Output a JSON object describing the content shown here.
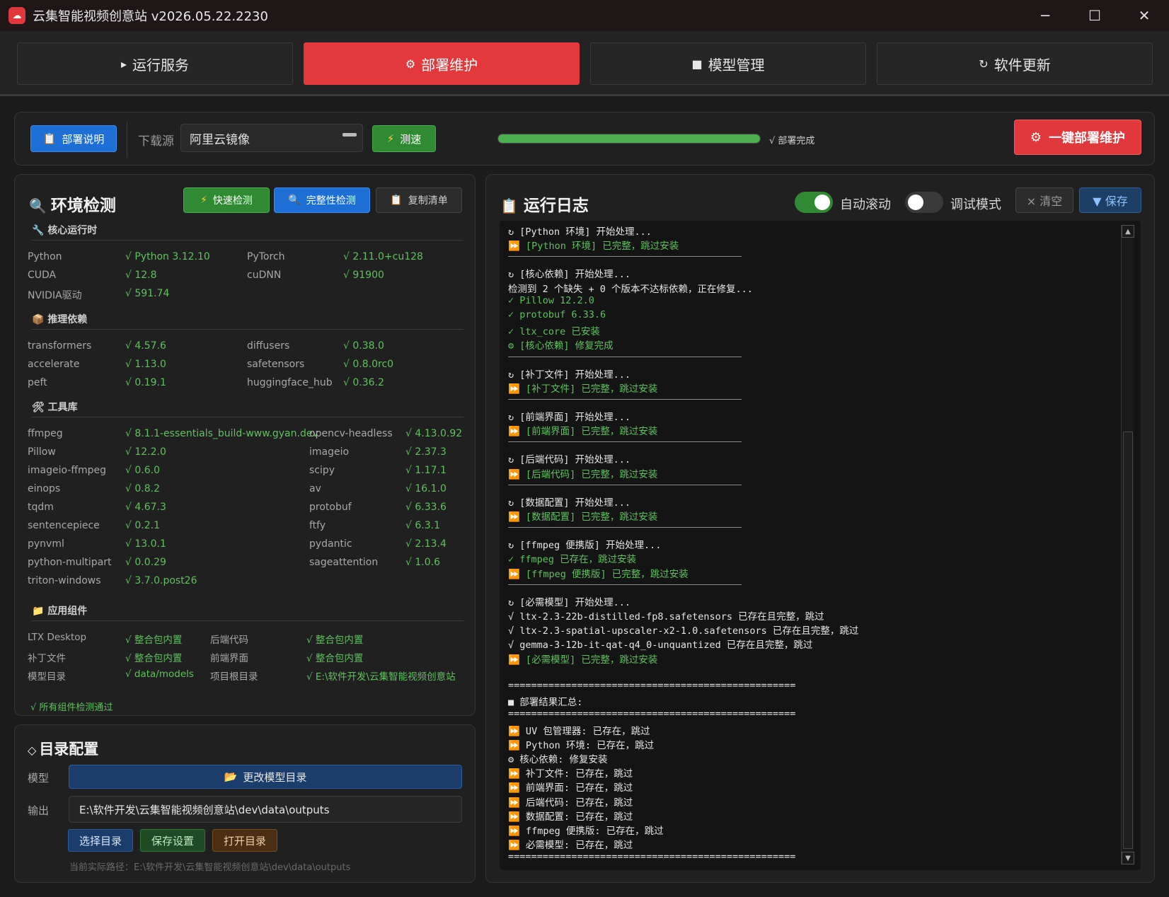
{
  "window": {
    "title": "云集智能视频创意站 v2026.05.22.2230",
    "logo_icon": "cloud-logo",
    "minimize": "─",
    "maximize": "☐",
    "close": "✕"
  },
  "tabs": [
    {
      "icon": "▸",
      "label": "运行服务",
      "active": false
    },
    {
      "icon": "⚙",
      "label": "部署维护",
      "active": true
    },
    {
      "icon": "■",
      "label": "模型管理",
      "active": false
    },
    {
      "icon": "↻",
      "label": "软件更新",
      "active": false
    }
  ],
  "toolbar": {
    "guide_button": "部署说明",
    "source_label": "下载源",
    "source_value": "阿里云镜像",
    "speedtest_button": "测速",
    "progress": 1.0,
    "progress_text": "√ 部署完成",
    "one_click_button": "一键部署维护"
  },
  "env": {
    "title": "环境检测",
    "quick_check": "快速检测",
    "full_check": "完整性检测",
    "copy_list": "复制清单",
    "sections": {
      "runtime": "核心运行时",
      "inference": "推理依赖",
      "tools": "工具库",
      "components": "应用组件"
    },
    "runtime": [
      [
        "Python",
        "√ Python 3.12.10",
        "PyTorch",
        "√ 2.11.0+cu128"
      ],
      [
        "CUDA",
        "√ 12.8",
        "cuDNN",
        "√ 91900"
      ],
      [
        "NVIDIA驱动",
        "√ 591.74",
        "",
        ""
      ]
    ],
    "inference": [
      [
        "transformers",
        "√ 4.57.6",
        "diffusers",
        "√ 0.38.0"
      ],
      [
        "accelerate",
        "√ 1.13.0",
        "safetensors",
        "√ 0.8.0rc0"
      ],
      [
        "peft",
        "√ 0.19.1",
        "huggingface_hub",
        "√ 0.36.2"
      ]
    ],
    "tools": [
      [
        "ffmpeg",
        "√ 8.1.1-essentials_build-www.gyan.dev",
        "opencv-headless",
        "√ 4.13.0.92"
      ],
      [
        "Pillow",
        "√ 12.2.0",
        "imageio",
        "√ 2.37.3"
      ],
      [
        "imageio-ffmpeg",
        "√ 0.6.0",
        "scipy",
        "√ 1.17.1"
      ],
      [
        "einops",
        "√ 0.8.2",
        "av",
        "√ 16.1.0"
      ],
      [
        "tqdm",
        "√ 4.67.3",
        "protobuf",
        "√ 6.33.6"
      ],
      [
        "sentencepiece",
        "√ 0.2.1",
        "ftfy",
        "√ 6.3.1"
      ],
      [
        "pynvml",
        "√ 13.0.1",
        "pydantic",
        "√ 2.13.4"
      ],
      [
        "python-multipart",
        "√ 0.0.29",
        "sageattention",
        "√ 1.0.6"
      ],
      [
        "triton-windows",
        "√ 3.7.0.post26",
        "",
        ""
      ]
    ],
    "components": [
      [
        "LTX Desktop",
        "√ 整合包内置",
        "后端代码",
        "√ 整合包内置"
      ],
      [
        "补丁文件",
        "√ 整合包内置",
        "前端界面",
        "√ 整合包内置"
      ],
      [
        "模型目录",
        "√ data/models",
        "项目根目录",
        "√ E:\\软件开发\\云集智能视频创意站"
      ]
    ],
    "summary": "√ 所有组件检测通过"
  },
  "dirs": {
    "title": "目录配置",
    "model_label": "模型",
    "change_model_button": "更改模型目录",
    "output_label": "输出",
    "output_value": "E:\\软件开发\\云集智能视频创意站\\dev\\data\\outputs",
    "choose_button": "选择目录",
    "save_button": "保存设置",
    "open_button": "打开目录",
    "current_path": "当前实际路径：E:\\软件开发\\云集智能视频创意站\\dev\\data\\outputs"
  },
  "log": {
    "title": "运行日志",
    "auto_scroll_label": "自动滚动",
    "auto_scroll_on": true,
    "debug_label": "调试模式",
    "debug_on": false,
    "clear_button": "× 清空",
    "save_button": "▼ 保存",
    "lines": [
      {
        "t": "↻ [Python 环境] 开始处理...",
        "c": "#e6e6e6"
      },
      {
        "t": "⏩ [Python 环境] 已完整，跳过安装",
        "c": "#5fc15f"
      },
      {
        "sep": true
      },
      {
        "t": "↻ [核心依赖] 开始处理...",
        "c": "#e6e6e6"
      },
      {
        "t": "检测到 2 个缺失 + 0 个版本不达标依赖，正在修复...",
        "c": "#e6e6e6"
      },
      {
        "t": "✓ Pillow 12.2.0",
        "c": "#5fc15f"
      },
      {
        "t": "✓ protobuf 6.33.6",
        "c": "#5fc15f"
      },
      {
        "t": "✓ ltx_core 已安装",
        "c": "#5fc15f"
      },
      {
        "t": "⚙ [核心依赖] 修复完成",
        "c": "#5fc15f"
      },
      {
        "sep": true
      },
      {
        "t": "↻ [补丁文件] 开始处理...",
        "c": "#e6e6e6"
      },
      {
        "t": "⏩ [补丁文件] 已完整，跳过安装",
        "c": "#5fc15f"
      },
      {
        "sep": true
      },
      {
        "t": "↻ [前端界面] 开始处理...",
        "c": "#e6e6e6"
      },
      {
        "t": "⏩ [前端界面] 已完整，跳过安装",
        "c": "#5fc15f"
      },
      {
        "sep": true
      },
      {
        "t": "↻ [后端代码] 开始处理...",
        "c": "#e6e6e6"
      },
      {
        "t": "⏩ [后端代码] 已完整，跳过安装",
        "c": "#5fc15f"
      },
      {
        "sep": true
      },
      {
        "t": "↻ [数据配置] 开始处理...",
        "c": "#e6e6e6"
      },
      {
        "t": "⏩ [数据配置] 已完整，跳过安装",
        "c": "#5fc15f"
      },
      {
        "sep": true
      },
      {
        "t": "↻ [ffmpeg 便携版] 开始处理...",
        "c": "#e6e6e6"
      },
      {
        "t": "✓ ffmpeg 已存在，跳过安装",
        "c": "#5fc15f"
      },
      {
        "t": "⏩ [ffmpeg 便携版] 已完整，跳过安装",
        "c": "#5fc15f"
      },
      {
        "sep": true
      },
      {
        "t": "↻ [必需模型] 开始处理...",
        "c": "#e6e6e6"
      },
      {
        "t": "√ ltx-2.3-22b-distilled-fp8.safetensors 已存在且完整，跳过",
        "c": "#e6e6e6"
      },
      {
        "t": "√ ltx-2.3-spatial-upscaler-x2-1.0.safetensors 已存在且完整，跳过",
        "c": "#e6e6e6"
      },
      {
        "t": "√ gemma-3-12b-it-qat-q4_0-unquantized 已存在且完整，跳过",
        "c": "#e6e6e6"
      },
      {
        "t": "⏩ [必需模型] 已完整，跳过安装",
        "c": "#5fc15f"
      },
      {
        "t": "",
        "c": "#e6e6e6"
      },
      {
        "t": "==================================================",
        "c": "#e6e6e6"
      },
      {
        "t": "■ 部署结果汇总:",
        "c": "#e6e6e6"
      },
      {
        "t": "==================================================",
        "c": "#e6e6e6"
      },
      {
        "t": "⏩ UV 包管理器: 已存在，跳过",
        "c": "#e6e6e6"
      },
      {
        "t": "⏩ Python 环境: 已存在，跳过",
        "c": "#e6e6e6"
      },
      {
        "t": "⚙ 核心依赖: 修复安装",
        "c": "#e6e6e6"
      },
      {
        "t": "⏩ 补丁文件: 已存在，跳过",
        "c": "#e6e6e6"
      },
      {
        "t": "⏩ 前端界面: 已存在，跳过",
        "c": "#e6e6e6"
      },
      {
        "t": "⏩ 后端代码: 已存在，跳过",
        "c": "#e6e6e6"
      },
      {
        "t": "⏩ 数据配置: 已存在，跳过",
        "c": "#e6e6e6"
      },
      {
        "t": "⏩ ffmpeg 便携版: 已存在，跳过",
        "c": "#e6e6e6"
      },
      {
        "t": "⏩ 必需模型: 已存在，跳过",
        "c": "#e6e6e6"
      },
      {
        "t": "==================================================",
        "c": "#e6e6e6"
      }
    ]
  },
  "colors": {
    "accent_red": "#e4393c",
    "accent_blue": "#1d6fd6",
    "accent_green": "#2f8a33",
    "ok_text": "#5fc15f"
  }
}
